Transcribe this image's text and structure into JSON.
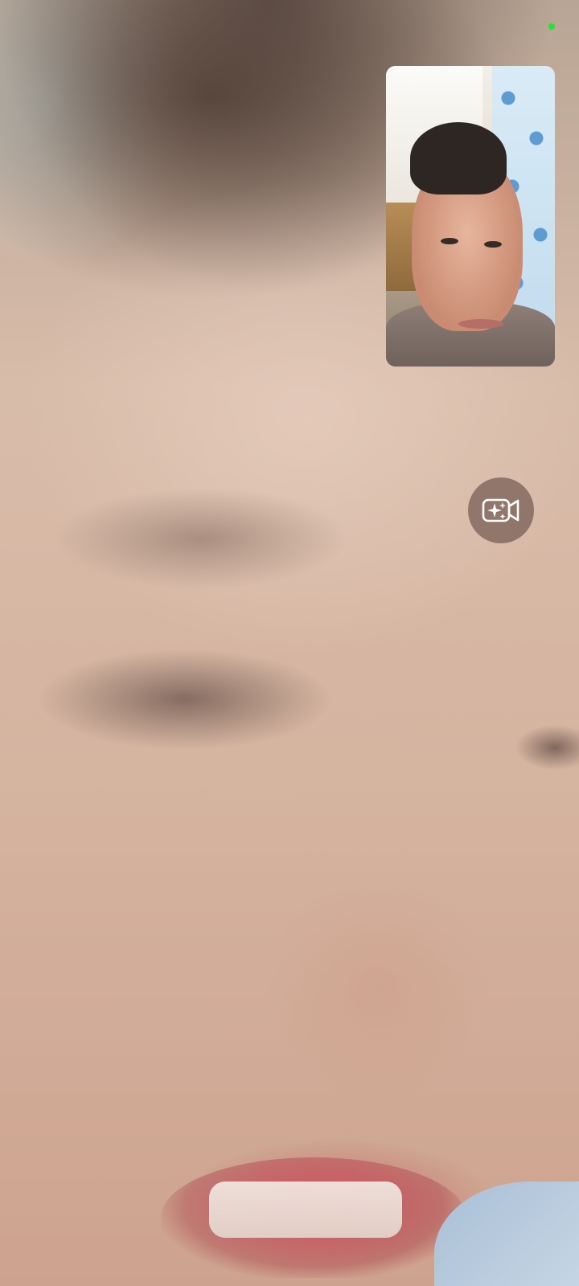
{
  "screen": "video-call",
  "remote_video": {
    "description_icon": "remote-participant-video"
  },
  "self_preview": {
    "icon": "self-camera-preview"
  },
  "indicators": {
    "camera_in_use_color": "#27e03a"
  },
  "controls": {
    "effects_button": {
      "icon": "camera-effects-icon"
    }
  },
  "colors": {
    "effects_button_bg": "#7a5f55",
    "icon_stroke": "#ffffff"
  }
}
